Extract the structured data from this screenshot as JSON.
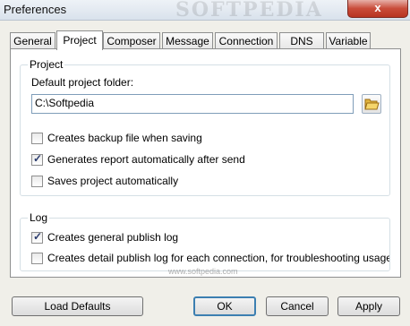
{
  "window": {
    "title": "Preferences",
    "watermark": "SOFTPEDIA",
    "close_glyph": "x"
  },
  "tabs": [
    {
      "label": "General"
    },
    {
      "label": "Project",
      "active": true
    },
    {
      "label": "Composer"
    },
    {
      "label": "Message"
    },
    {
      "label": "Connection"
    },
    {
      "label": "DNS"
    },
    {
      "label": "Variable"
    }
  ],
  "project": {
    "group_label": "Project",
    "folder_label": "Default project folder:",
    "folder_value": "C:\\Softpedia",
    "browse_icon": "folder-open-icon",
    "checks": [
      {
        "label": "Creates backup file when saving",
        "checked": false
      },
      {
        "label": "Generates report automatically after send",
        "checked": true
      },
      {
        "label": "Saves project automatically",
        "checked": false
      }
    ]
  },
  "log": {
    "group_label": "Log",
    "checks": [
      {
        "label": "Creates general publish log",
        "checked": true
      },
      {
        "label": "Creates detail publish log for each connection, for troubleshooting usage",
        "checked": false
      }
    ]
  },
  "footer_watermark": "www.softpedia.com",
  "buttons": {
    "load_defaults": "Load Defaults",
    "ok": "OK",
    "cancel": "Cancel",
    "apply": "Apply"
  },
  "colors": {
    "accent": "#3c7fb1",
    "close": "#c94c3a"
  }
}
